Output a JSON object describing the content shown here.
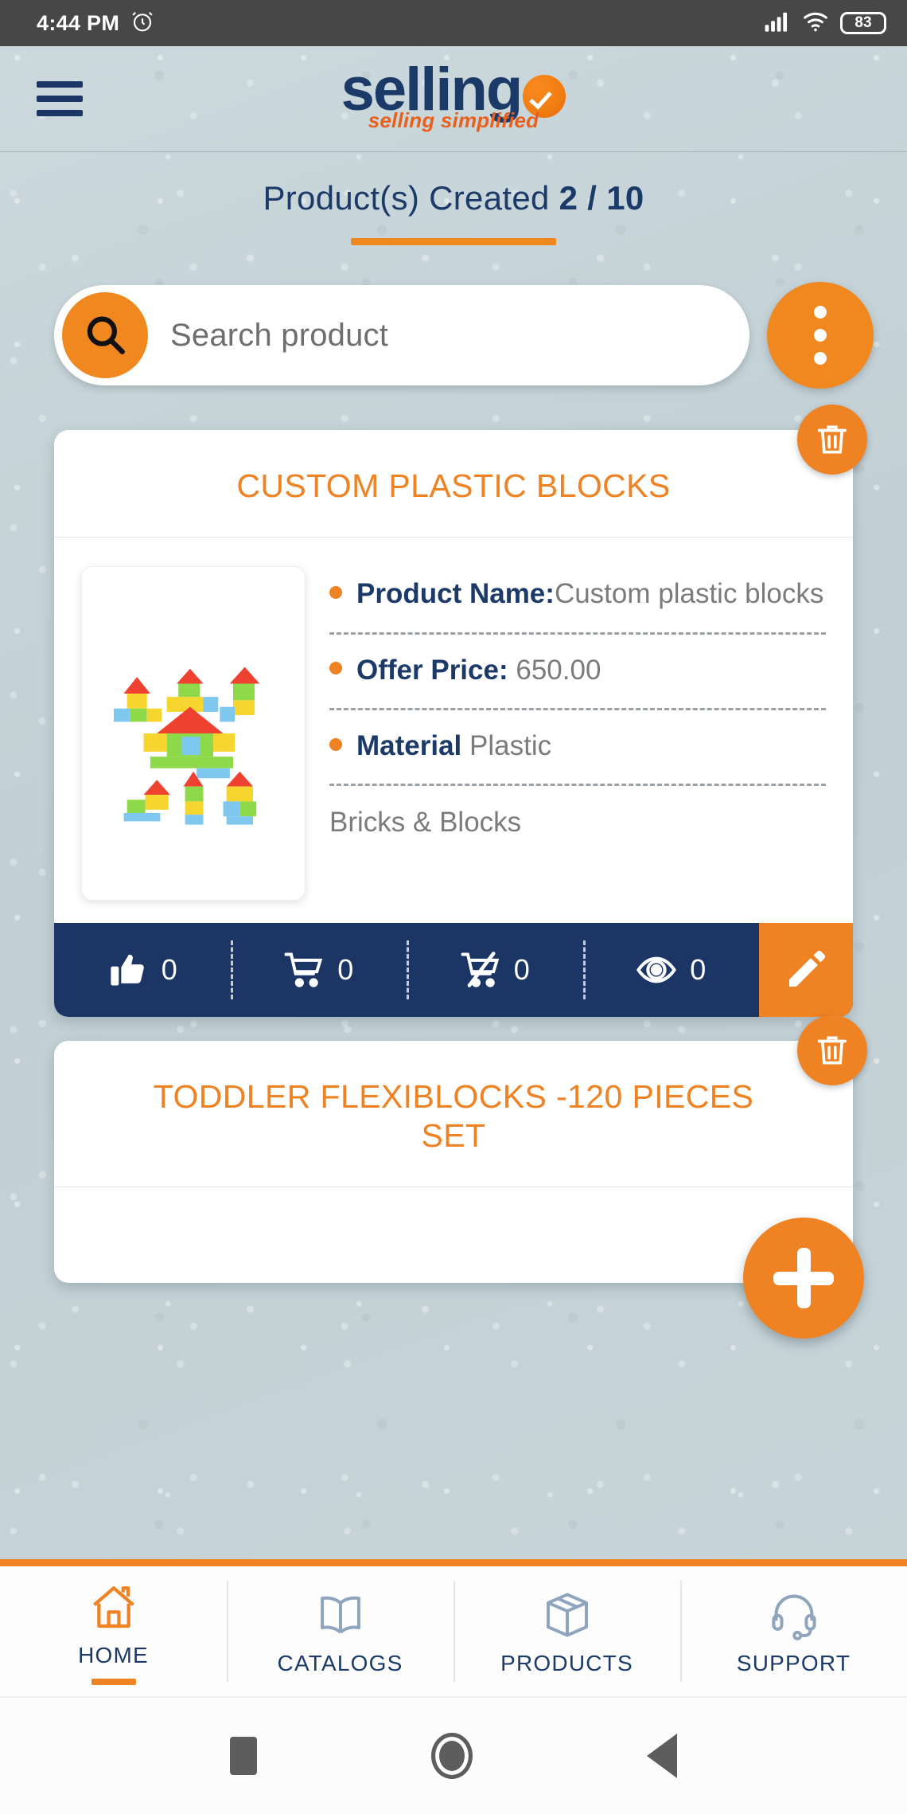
{
  "status_bar": {
    "time": "4:44 PM",
    "alarm_icon": "alarm-clock-icon",
    "signal_icon": "cellular-signal-icon",
    "wifi_icon": "wifi-icon",
    "battery_level": "83"
  },
  "header": {
    "menu_icon": "hamburger-menu-icon",
    "logo_text": "sellingo",
    "logo_word_main": "selling",
    "logo_badge_icon": "check-circle-icon",
    "tagline": "selling simplified",
    "colors": {
      "navy": "#1b3a68",
      "orange": "#ef8222"
    }
  },
  "counter": {
    "label": "Product(s) Created",
    "value": "2 / 10"
  },
  "search": {
    "icon": "search-icon",
    "placeholder": "Search product",
    "value": "",
    "overflow_icon": "more-vertical-icon"
  },
  "products": [
    {
      "title": "CUSTOM PLASTIC BLOCKS",
      "image_alt": "plastic-building-blocks-houses",
      "delete_icon": "trash-icon",
      "edit_icon": "pencil-icon",
      "specs": [
        {
          "label": "Product Name:",
          "value": "Custom plastic blocks"
        },
        {
          "label": "Offer Price:",
          "value": "650.00"
        },
        {
          "label": "Material",
          "value": "Plastic"
        }
      ],
      "category": "Bricks & Blocks",
      "stats": [
        {
          "icon": "thumbs-up-icon",
          "count": "0"
        },
        {
          "icon": "cart-icon",
          "count": "0"
        },
        {
          "icon": "cart-removed-icon",
          "count": "0"
        },
        {
          "icon": "eye-icon",
          "count": "0"
        }
      ]
    },
    {
      "title": "TODDLER FLEXIBLOCKS -120 PIECES SET",
      "delete_icon": "trash-icon"
    }
  ],
  "fab": {
    "icon": "plus-icon",
    "label": "Add product"
  },
  "bottom_nav": [
    {
      "label": "HOME",
      "icon": "home-icon",
      "active": true
    },
    {
      "label": "CATALOGS",
      "icon": "book-icon",
      "active": false
    },
    {
      "label": "PRODUCTS",
      "icon": "box-icon",
      "active": false
    },
    {
      "label": "SUPPORT",
      "icon": "headset-icon",
      "active": false
    }
  ],
  "android_nav": {
    "recents_icon": "square-icon",
    "home_icon": "circle-icon",
    "back_icon": "triangle-left-icon"
  }
}
